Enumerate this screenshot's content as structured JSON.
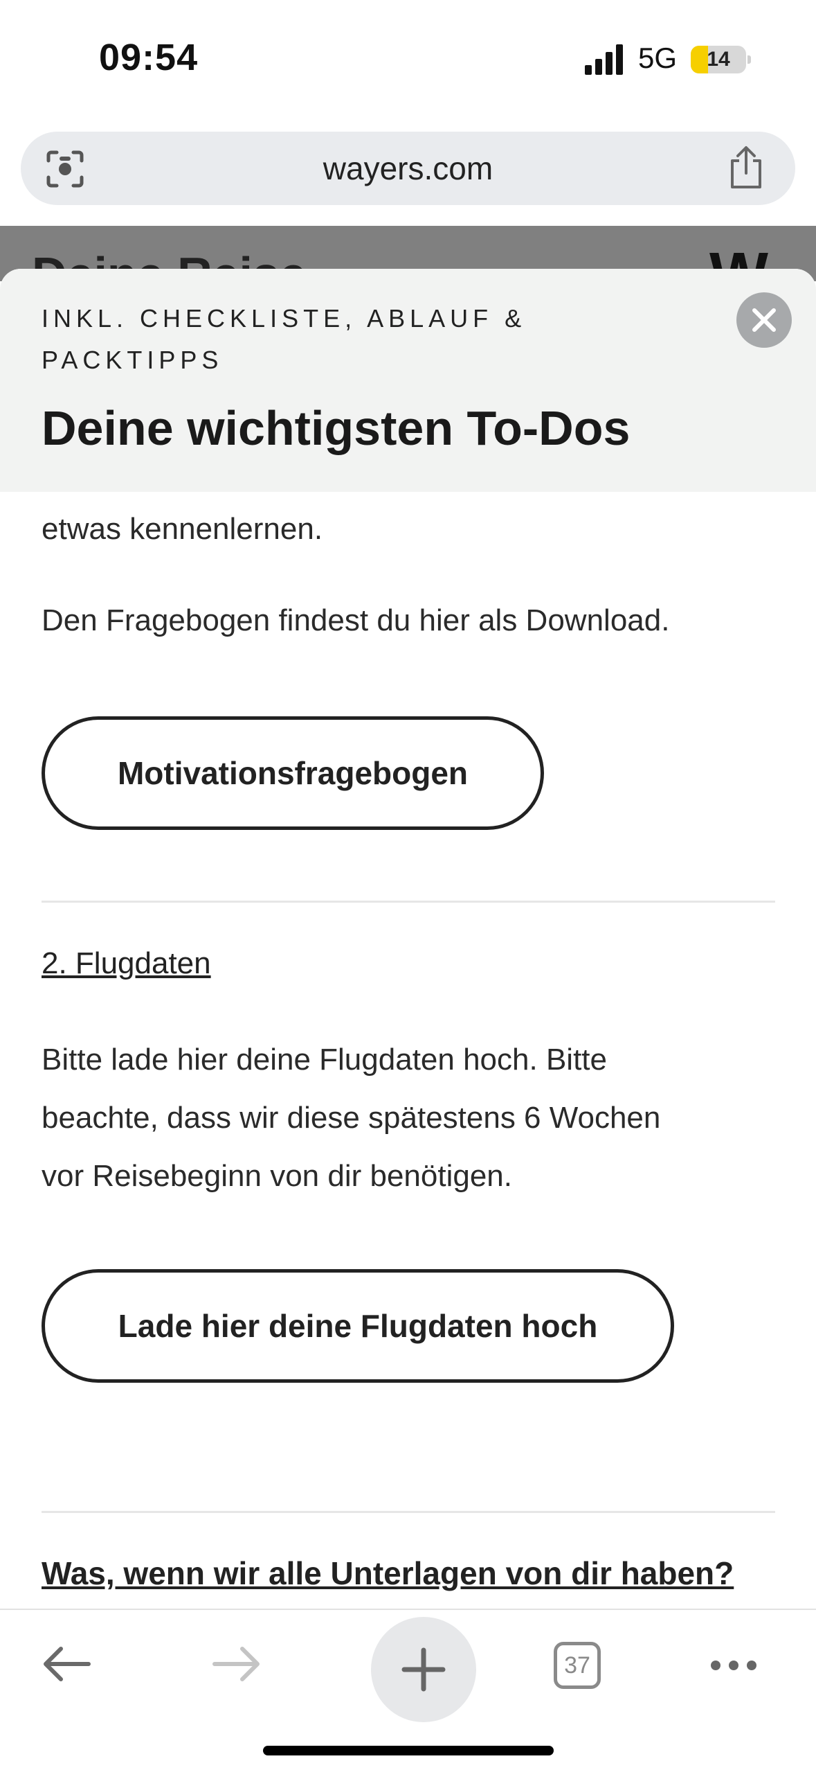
{
  "status_bar": {
    "time": "09:54",
    "network": "5G",
    "battery": "14",
    "battery_fraction": 0.14
  },
  "browser": {
    "url": "wayers.com"
  },
  "page_behind": {
    "title": "Deine Reise",
    "logo": "W"
  },
  "sheet": {
    "eyebrow": "INKL. CHECKLISTE, ABLAUF & PACKTIPPS",
    "title": "Deine wichtigsten To-Dos",
    "body": {
      "cut_line": "etwas kennenlernen.",
      "questionnaire_text": "Den Fragebogen findest du hier als Download.",
      "questionnaire_button": "Motivationsfragebogen",
      "section2_heading": "2. Flugdaten ",
      "flight_line1": "Bitte lade hier deine Flugdaten hoch. Bitte",
      "flight_line2": "beachte, dass wir diese spätestens 6 Wochen",
      "flight_line3": "vor Reisebeginn von dir benötigen.",
      "flight_button": "Lade hier deine Flugdaten hoch",
      "next_question": "Was, wenn wir alle Unterlagen von dir haben?"
    }
  },
  "toolbar": {
    "tab_count": "37"
  },
  "icons": {
    "status": [
      "signal-icon"
    ],
    "urlbar": [
      "camera-search-icon",
      "share-icon"
    ],
    "sheet": [
      "close-icon"
    ],
    "toolbar": [
      "back-arrow-icon",
      "forward-arrow-icon",
      "plus-icon",
      "tabs-icon",
      "more-icon"
    ]
  }
}
